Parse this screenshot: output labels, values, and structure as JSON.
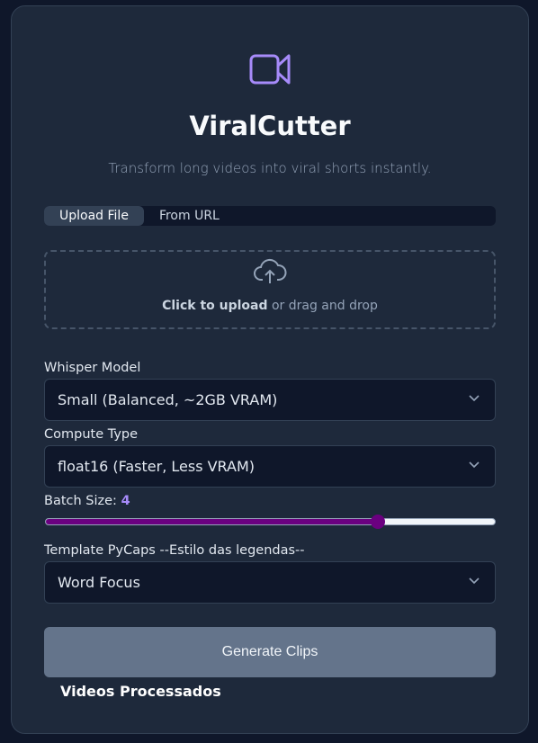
{
  "app": {
    "title": "ViralCutter",
    "subtitle": "Transform long videos into viral shorts instantly.",
    "logo_icon": "video-camera-icon",
    "accent": "#a78bfa"
  },
  "tabs": [
    {
      "label": "Upload File",
      "active": true
    },
    {
      "label": "From URL",
      "active": false
    }
  ],
  "upload": {
    "icon": "cloud-upload-icon",
    "cta": "Click to upload",
    "rest": " or drag and drop"
  },
  "whisper": {
    "label": "Whisper Model",
    "value": "Small (Balanced, ~2GB VRAM)"
  },
  "compute": {
    "label": "Compute Type",
    "value": "float16 (Faster, Less VRAM)"
  },
  "batch": {
    "label": "Batch Size: ",
    "value": "4",
    "fill_fraction": 0.74,
    "color": "#6b0080"
  },
  "template": {
    "label": "Template PyCaps --Estilo das legendas--",
    "value": "Word Focus"
  },
  "generate_label": "Generate Clips",
  "processed_heading": "Videos Processados"
}
